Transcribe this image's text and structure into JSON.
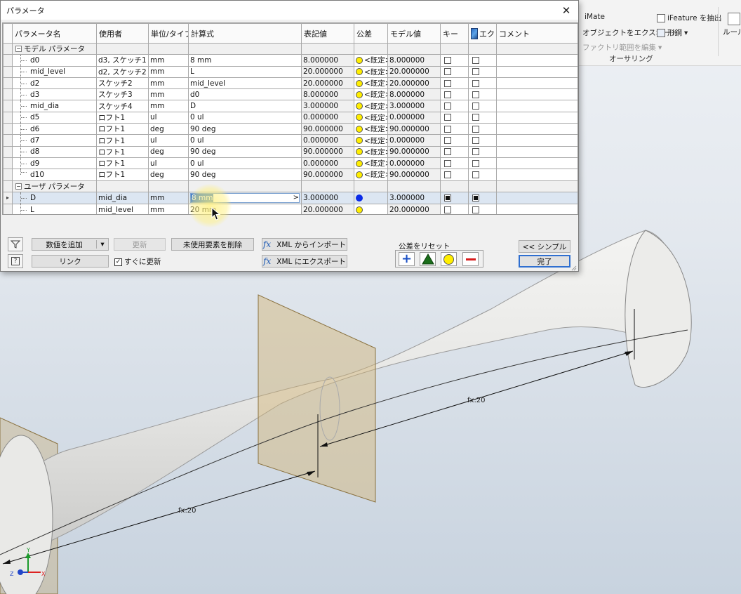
{
  "dialog": {
    "title": "パラメータ",
    "close_label": "✕"
  },
  "columns": [
    "パラメータ名",
    "使用者",
    "単位/タイプ",
    "計算式",
    "表記値",
    "公差",
    "モデル値",
    "キー",
    "エク",
    "コメント"
  ],
  "groups": {
    "model": "モデル パラメータ",
    "user": "ユーザ パラメータ"
  },
  "model_params": [
    {
      "name": "d0",
      "used_by": "d3, スケッチ1",
      "unit": "mm",
      "equation": "8 mm",
      "nominal": "8.000000",
      "tolerance": "<既定>",
      "model_value": "8.000000"
    },
    {
      "name": "mid_level",
      "used_by": "d2, スケッチ2",
      "unit": "mm",
      "equation": "L",
      "nominal": "20.000000",
      "tolerance": "<既定>",
      "model_value": "20.000000"
    },
    {
      "name": "d2",
      "used_by": "スケッチ2",
      "unit": "mm",
      "equation": "mid_level",
      "nominal": "20.000000",
      "tolerance": "<既定>",
      "model_value": "20.000000"
    },
    {
      "name": "d3",
      "used_by": "スケッチ3",
      "unit": "mm",
      "equation": "d0",
      "nominal": "8.000000",
      "tolerance": "<既定>",
      "model_value": "8.000000"
    },
    {
      "name": "mid_dia",
      "used_by": "スケッチ4",
      "unit": "mm",
      "equation": "D",
      "nominal": "3.000000",
      "tolerance": "<既定>",
      "model_value": "3.000000"
    },
    {
      "name": "d5",
      "used_by": "ロフト1",
      "unit": "ul",
      "equation": "0 ul",
      "nominal": "0.000000",
      "tolerance": "<既定>",
      "model_value": "0.000000"
    },
    {
      "name": "d6",
      "used_by": "ロフト1",
      "unit": "deg",
      "equation": "90 deg",
      "nominal": "90.000000",
      "tolerance": "<既定>",
      "model_value": "90.000000"
    },
    {
      "name": "d7",
      "used_by": "ロフト1",
      "unit": "ul",
      "equation": "0 ul",
      "nominal": "0.000000",
      "tolerance": "<既定>",
      "model_value": "0.000000"
    },
    {
      "name": "d8",
      "used_by": "ロフト1",
      "unit": "deg",
      "equation": "90 deg",
      "nominal": "90.000000",
      "tolerance": "<既定>",
      "model_value": "90.000000"
    },
    {
      "name": "d9",
      "used_by": "ロフト1",
      "unit": "ul",
      "equation": "0 ul",
      "nominal": "0.000000",
      "tolerance": "<既定>",
      "model_value": "0.000000"
    },
    {
      "name": "d10",
      "used_by": "ロフト1",
      "unit": "deg",
      "equation": "90 deg",
      "nominal": "90.000000",
      "tolerance": "<既定>",
      "model_value": "90.000000"
    }
  ],
  "user_params": [
    {
      "name": "D",
      "used_by": "mid_dia",
      "unit": "mm",
      "equation": "8 mm",
      "nominal": "3.000000",
      "model_value": "3.000000",
      "arrow": ">"
    },
    {
      "name": "L",
      "used_by": "mid_level",
      "unit": "mm",
      "equation": "20 mm",
      "nominal": "20.000000",
      "model_value": "20.000000"
    }
  ],
  "buttons": {
    "add_number": "数値を追加",
    "update": "更新",
    "purge_unused": "未使用要素を削除",
    "xml_import": "XML からインポート",
    "link": "リンク",
    "immediate_update": "すぐに更新",
    "xml_export": "XML にエクスポート",
    "simple": "<< シンプル",
    "done": "完了",
    "reset_tolerance_label": "公差をリセット",
    "fx": "fx"
  },
  "ribbon": {
    "imate": "iMate",
    "ifeature": "iFeature を抽出",
    "export_objects": "オブジェクトをエクスポート",
    "sheet_metal": "形鋼",
    "edit_factory": "ファクトリ範囲を編集",
    "group": "オーサリング",
    "rules": "ルール"
  },
  "viewport": {
    "dim_label_1": "fx:20",
    "dim_label_2": "fx:20",
    "axis_x": "X",
    "axis_y": "Y",
    "axis_z": "Z"
  },
  "colors": {
    "tolerance_default": "#ffee00",
    "tolerance_selected": "#0a2be8",
    "selection_row": "#dce6f2",
    "plane": "#c8a86a"
  }
}
